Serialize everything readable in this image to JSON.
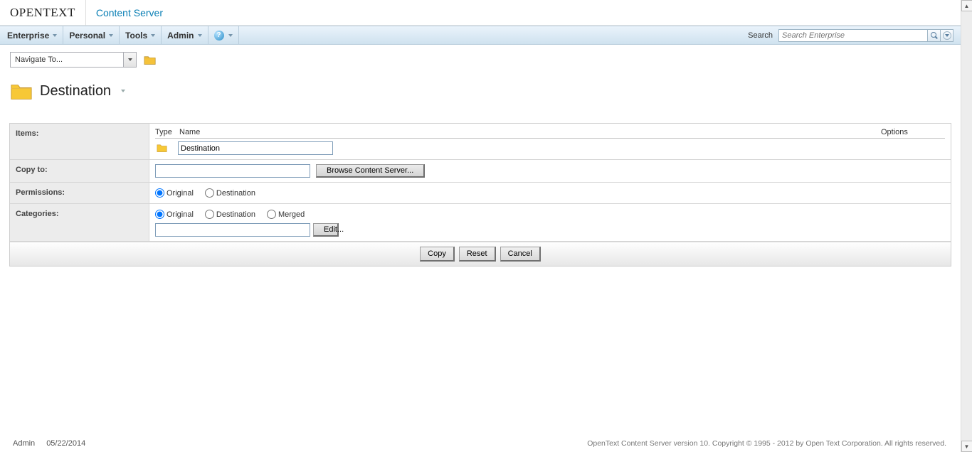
{
  "brand": {
    "company": "OPENTEXT",
    "app": "Content Server"
  },
  "menu": {
    "items": [
      "Enterprise",
      "Personal",
      "Tools",
      "Admin"
    ],
    "search_label": "Search",
    "search_placeholder": "Search Enterprise"
  },
  "nav": {
    "navigate_label": "Navigate To..."
  },
  "page": {
    "title": "Destination"
  },
  "form": {
    "items": {
      "label": "Items:",
      "col_type": "Type",
      "col_name": "Name",
      "col_options": "Options",
      "item_name": "Destination"
    },
    "copy_to": {
      "label": "Copy to:",
      "value": "",
      "browse_btn": "Browse Content Server..."
    },
    "permissions": {
      "label": "Permissions:",
      "opt_original": "Original",
      "opt_destination": "Destination"
    },
    "categories": {
      "label": "Categories:",
      "opt_original": "Original",
      "opt_destination": "Destination",
      "opt_merged": "Merged",
      "field_value": "",
      "edit_btn": "Edit..."
    },
    "actions": {
      "copy": "Copy",
      "reset": "Reset",
      "cancel": "Cancel"
    }
  },
  "footer": {
    "user": "Admin",
    "date": "05/22/2014",
    "copyright": "OpenText Content Server version 10. Copyright © 1995 - 2012 by Open Text Corporation. All rights reserved."
  }
}
